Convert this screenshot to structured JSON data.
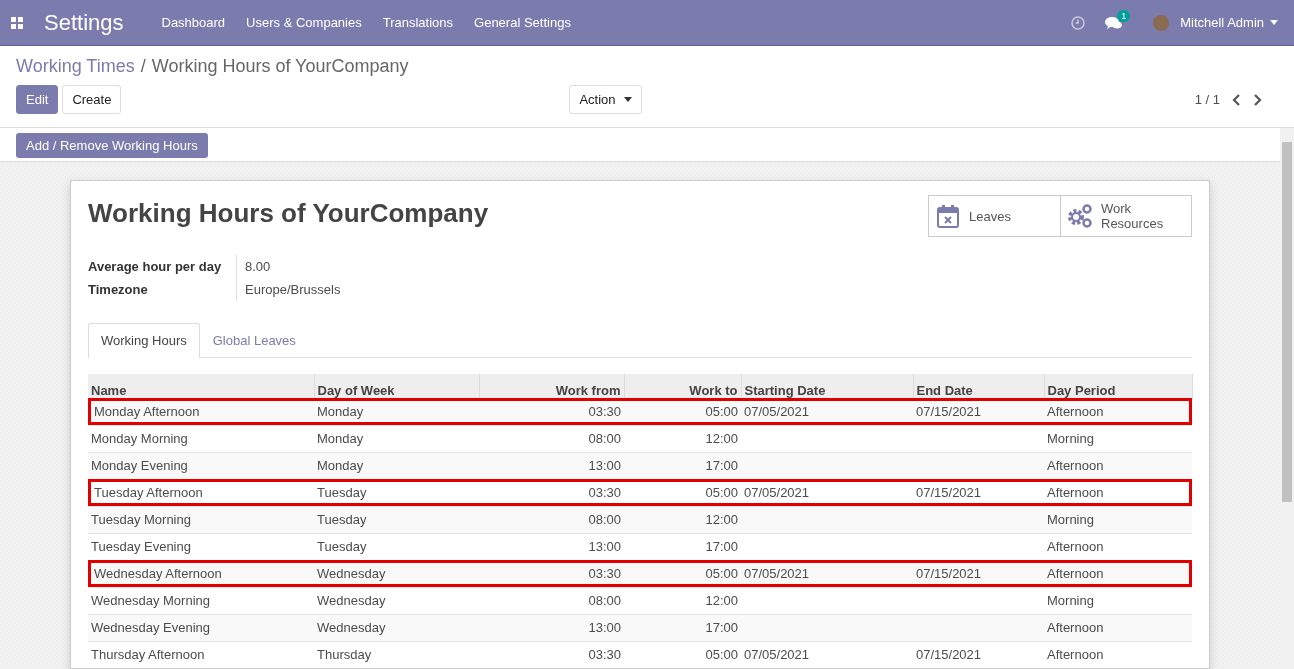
{
  "navbar": {
    "app_title": "Settings",
    "menu": [
      "Dashboard",
      "Users & Companies",
      "Translations",
      "General Settings"
    ],
    "messages_badge": "1",
    "user": "Mitchell Admin"
  },
  "breadcrumb": {
    "parent": "Working Times",
    "separator": "/",
    "current": "Working Hours of YourCompany"
  },
  "buttons": [
    {
      "label": "Edit",
      "kind": "primary"
    },
    {
      "label": "Create",
      "kind": "secondary"
    }
  ],
  "action": "Action",
  "pager": "1 / 1",
  "header_button": "Add / Remove Working Hours",
  "sheet": {
    "title": "Working Hours of YourCompany",
    "smart_buttons": [
      {
        "label": "Leaves",
        "kind": "calendar"
      },
      {
        "label": "Work Resources",
        "kind": "gears"
      }
    ],
    "fields": [
      {
        "label": "Average hour per day",
        "value": "8.00"
      },
      {
        "label": "Timezone",
        "value": "Europe/Brussels"
      }
    ],
    "tabs": [
      {
        "label": "Working Hours",
        "selected": true
      },
      {
        "label": "Global Leaves",
        "selected": false
      }
    ],
    "table": {
      "columns": [
        {
          "label": "Name",
          "kind": "text"
        },
        {
          "label": "Day of Week",
          "kind": "text"
        },
        {
          "label": "Work from",
          "kind": "time"
        },
        {
          "label": "Work to",
          "kind": "time"
        },
        {
          "label": "Starting Date",
          "kind": "text"
        },
        {
          "label": "End Date",
          "kind": "text"
        },
        {
          "label": "Day Period",
          "kind": "text"
        }
      ],
      "rows": [
        {
          "cells": [
            "Monday Afternoon",
            "Monday",
            "03:30",
            "05:00",
            "07/05/2021",
            "07/15/2021",
            "Afternoon"
          ],
          "highlighted": true
        },
        {
          "cells": [
            "Monday Morning",
            "Monday",
            "08:00",
            "12:00",
            "",
            "",
            "Morning"
          ],
          "highlighted": false
        },
        {
          "cells": [
            "Monday Evening",
            "Monday",
            "13:00",
            "17:00",
            "",
            "",
            "Afternoon"
          ],
          "highlighted": false
        },
        {
          "cells": [
            "Tuesday Afternoon",
            "Tuesday",
            "03:30",
            "05:00",
            "07/05/2021",
            "07/15/2021",
            "Afternoon"
          ],
          "highlighted": true
        },
        {
          "cells": [
            "Tuesday Morning",
            "Tuesday",
            "08:00",
            "12:00",
            "",
            "",
            "Morning"
          ],
          "highlighted": false
        },
        {
          "cells": [
            "Tuesday Evening",
            "Tuesday",
            "13:00",
            "17:00",
            "",
            "",
            "Afternoon"
          ],
          "highlighted": false
        },
        {
          "cells": [
            "Wednesday Afternoon",
            "Wednesday",
            "03:30",
            "05:00",
            "07/05/2021",
            "07/15/2021",
            "Afternoon"
          ],
          "highlighted": true
        },
        {
          "cells": [
            "Wednesday Morning",
            "Wednesday",
            "08:00",
            "12:00",
            "",
            "",
            "Morning"
          ],
          "highlighted": false
        },
        {
          "cells": [
            "Wednesday Evening",
            "Wednesday",
            "13:00",
            "17:00",
            "",
            "",
            "Afternoon"
          ],
          "highlighted": false
        },
        {
          "cells": [
            "Thursday Afternoon",
            "Thursday",
            "03:30",
            "05:00",
            "07/05/2021",
            "07/15/2021",
            "Afternoon"
          ],
          "highlighted": false
        }
      ]
    }
  }
}
